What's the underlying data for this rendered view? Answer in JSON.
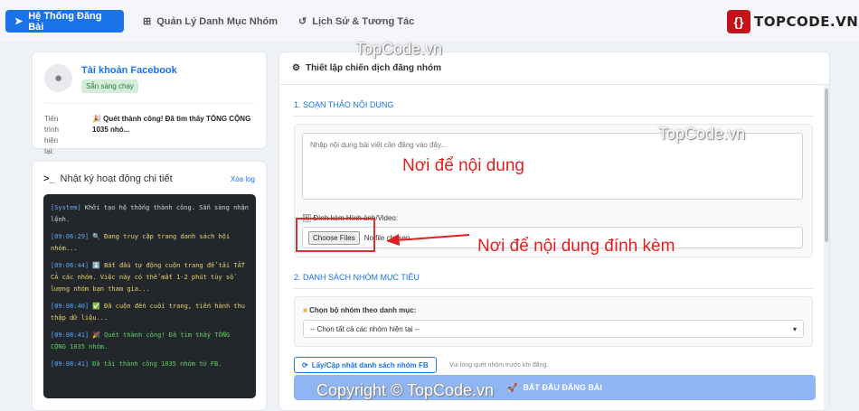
{
  "nav": {
    "tabs": [
      {
        "label": "Hệ Thống Đăng Bài",
        "icon": "paper-plane-icon",
        "active": true
      },
      {
        "label": "Quản Lý Danh Mục Nhóm",
        "icon": "sitemap-icon",
        "active": false
      },
      {
        "label": "Lịch Sử & Tương Tác",
        "icon": "history-icon",
        "active": false
      }
    ],
    "logo_text": "TOPCODE.VN"
  },
  "account": {
    "title": "Tài khoản Facebook",
    "status_badge": "Sẵn sàng chạy",
    "progress_label": "Tiến trình hiện tại:",
    "progress_text": "🎉 Quét thành công! Đã tìm thấy TỔNG CỘNG 1035 nhó..."
  },
  "log": {
    "title": "Nhật ký hoạt động chi tiết",
    "clear_label": "Xóa log",
    "entries": [
      {
        "time": "[System]",
        "text": "Khởi tạo hệ thống thành công. Sẵn sàng nhận lệnh.",
        "color": "#cfd3d7"
      },
      {
        "time": "[09:06:29]",
        "text": "🔍 Đang truy cập trang danh sách hội nhóm...",
        "color": "#e8d36a"
      },
      {
        "time": "[09:06:44]",
        "text": "⬇️ Bắt đầu tự động cuộn trang để tải TẤT CẢ các nhóm. Việc này có thể mất 1-2 phút tùy số lượng nhóm bạn tham gia...",
        "color": "#e8d36a"
      },
      {
        "time": "[09:08:40]",
        "text": "✅ Đã cuộn đến cuối trang, tiến hành thu thập dữ liệu...",
        "color": "#e8d36a"
      },
      {
        "time": "[09:08:41]",
        "text": "🎉 Quét thành công! Đã tìm thấy TỔNG CỘNG 1035 nhóm.",
        "color": "#5fd35f"
      },
      {
        "time": "[09:08:41]",
        "text": "Đã tải thành công 1035 nhóm từ FB.",
        "color": "#5fd35f"
      }
    ],
    "time_color": "#5aa9ff"
  },
  "campaign": {
    "title": "Thiết lập chiến dịch đăng nhóm",
    "section1_title": "1. SOẠN THẢO NỘI DUNG",
    "content_placeholder": "Nhập nội dung bài viết cần đăng vào đây...",
    "attach_label": "Đính kèm Hình ảnh/Video:",
    "file_button": "Choose Files",
    "file_none": "No file chosen",
    "section2_title": "2. DANH SÁCH NHÓM MỤC TIÊU",
    "category_label": "Chọn bộ nhóm theo danh mục:",
    "category_selected": "-- Chọn tất cả các nhóm hiện tại --",
    "load_button": "Lấy/Cập nhật danh sách nhóm FB",
    "load_hint": "Vui lòng quét nhóm trước khi đăng.",
    "start_button": "BẮT ĐẦU ĐĂNG BÀI"
  },
  "annotations": {
    "content_note": "Nơi để nội dung",
    "attach_note": "Nơi để nội dung đính kèm",
    "annotation_color": "#e02020"
  },
  "watermarks": {
    "top": "TopCode.vn",
    "right": "TopCode.vn",
    "bottom": "Copyright © TopCode.vn"
  }
}
